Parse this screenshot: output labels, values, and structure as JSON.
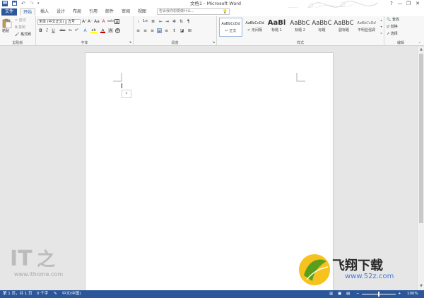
{
  "window": {
    "title": "文档1 - Microsoft Word",
    "controls": {
      "help": "?",
      "minimize": "—",
      "restore": "❐",
      "close": "✕"
    }
  },
  "quick_access": {
    "app_icon": "W",
    "save_icon": "save-icon",
    "undo_icon": "undo-icon",
    "redo_icon": "redo-icon"
  },
  "tabs": [
    "文件",
    "开始",
    "插入",
    "设计",
    "布局",
    "引用",
    "邮件",
    "审阅",
    "视图"
  ],
  "active_tab": "开始",
  "tell_me": {
    "placeholder": "告诉我你想要做什么..."
  },
  "ribbon": {
    "clipboard": {
      "label": "剪贴板",
      "paste": "粘贴",
      "cut": "剪切",
      "copy": "复制",
      "format_painter": "格式刷"
    },
    "font": {
      "label": "字体",
      "font_name": "宋体 (中文正文)",
      "font_size": "五号",
      "grow": "A⁺",
      "shrink": "A⁻",
      "case": "Aa",
      "clear": "A",
      "phonetic": "wén",
      "border_char": "A",
      "bold": "B",
      "italic": "I",
      "underline": "U",
      "strike": "abc",
      "sub": "x₂",
      "sup": "x²",
      "effects": "A",
      "highlight": "ab",
      "color": "A",
      "shading": "A",
      "circle": "字"
    },
    "paragraph": {
      "label": "段落"
    },
    "styles": {
      "label": "样式",
      "items": [
        {
          "preview": "AaBbCcDd",
          "name": "↵ 正文"
        },
        {
          "preview": "AaBbCcDd",
          "name": "↵ 无间隔"
        },
        {
          "preview": "AaBl",
          "name": "标题 1"
        },
        {
          "preview": "AaBbC",
          "name": "标题 2"
        },
        {
          "preview": "AaBbC",
          "name": "标题"
        },
        {
          "preview": "AaBbC",
          "name": "副标题"
        },
        {
          "preview": "AaBbCcDd",
          "name": "不明显强调"
        }
      ]
    },
    "editing": {
      "label": "编辑",
      "find": "查找",
      "replace": "替换",
      "select": "选择"
    }
  },
  "statusbar": {
    "page": "第 1 页，共 1 页",
    "words": "0 个字",
    "language": "中文(中国)",
    "zoom_minus": "−",
    "zoom_plus": "+",
    "zoom": "100%"
  },
  "watermarks": {
    "left_site": "www.ithome.com",
    "right_logo": "飞翔下载",
    "right_site": "www.52z.com"
  },
  "colors": {
    "accent": "#2b579a",
    "highlight": "#ffff00",
    "font_color": "#c00000",
    "watermark_green": "#5a9e1e"
  }
}
